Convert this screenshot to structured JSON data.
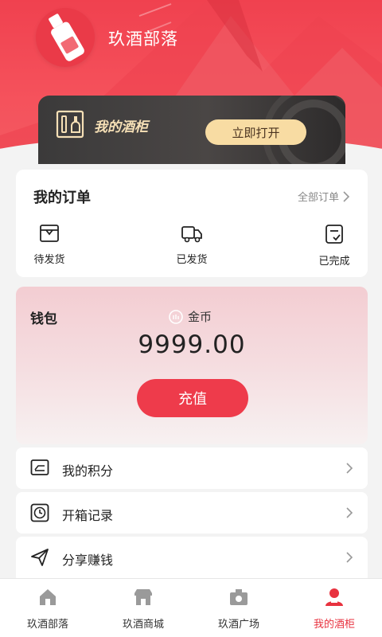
{
  "app": {
    "title": "玖酒部落"
  },
  "cabinet": {
    "title": "我的酒柜",
    "open_label": "立即打开"
  },
  "orders": {
    "title": "我的订单",
    "all_label": "全部订单",
    "items": [
      {
        "label": "待发货",
        "icon": "package-icon"
      },
      {
        "label": "已发货",
        "icon": "truck-icon"
      },
      {
        "label": "已完成",
        "icon": "receipt-check-icon"
      }
    ]
  },
  "wallet": {
    "title": "钱包",
    "coin_label": "金币",
    "amount": "9999.00",
    "recharge_label": "充值"
  },
  "menu": [
    {
      "label": "我的积分",
      "icon": "points-card-icon"
    },
    {
      "label": "开箱记录",
      "icon": "clock-icon"
    },
    {
      "label": "分享赚钱",
      "icon": "send-icon"
    }
  ],
  "tabs": [
    {
      "label": "玖酒部落",
      "icon": "home-icon",
      "active": false
    },
    {
      "label": "玖酒商城",
      "icon": "store-icon",
      "active": false
    },
    {
      "label": "玖酒广场",
      "icon": "camera-icon",
      "active": false
    },
    {
      "label": "我的酒柜",
      "icon": "user-icon",
      "active": true
    }
  ],
  "colors": {
    "brand_red": "#ee3b4b",
    "gold": "#f8dca3",
    "active_tab": "#e8323f"
  }
}
